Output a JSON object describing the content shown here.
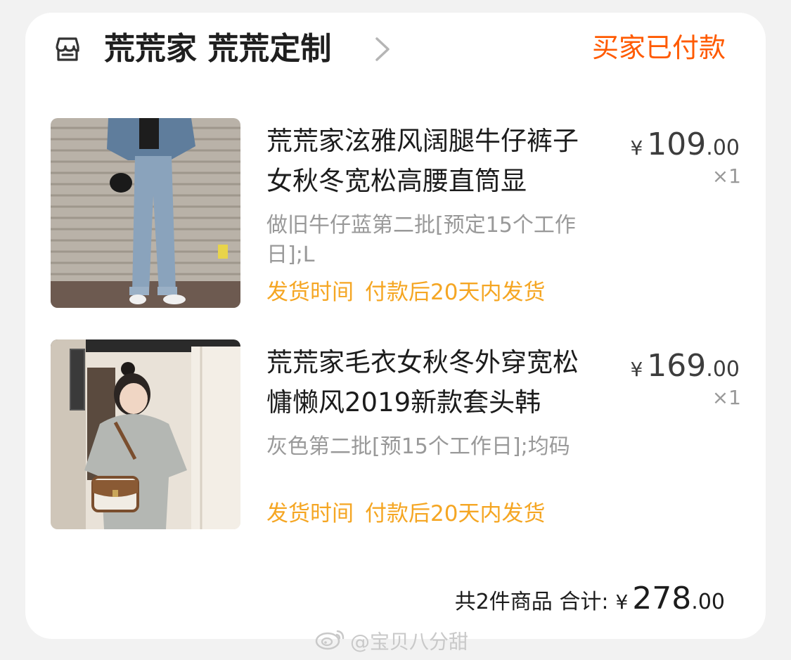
{
  "shop": {
    "name": "荒荒家 荒荒定制",
    "icon": "store-icon",
    "chevron_icon": "chevron-right-icon",
    "status": "买家已付款",
    "status_color": "#ff5a00"
  },
  "items": [
    {
      "image": "product-photo-jeans",
      "title": "荒荒家泫雅风阔腿牛仔裤子女秋冬宽松高腰直筒显",
      "sku": "做旧牛仔蓝第二批[预定15个工作日];L",
      "ship_label": "发货时间",
      "ship_value": "付款后20天内发货",
      "price_symbol": "¥",
      "price_int": "109",
      "price_dec": ".00",
      "qty": "×1"
    },
    {
      "image": "product-photo-sweater",
      "title": "荒荒家毛衣女秋冬外穿宽松慵懒风2019新款套头韩",
      "sku": "灰色第二批[预15个工作日];均码",
      "ship_label": "发货时间",
      "ship_value": "付款后20天内发货",
      "price_symbol": "¥",
      "price_int": "169",
      "price_dec": ".00",
      "qty": "×1"
    }
  ],
  "summary": {
    "count_text": "共2件商品",
    "total_label": "合计:",
    "total_symbol": "¥",
    "total_int": "278",
    "total_dec": ".00"
  },
  "watermark": {
    "text": "@宝贝八分甜",
    "icon": "weibo-icon"
  },
  "colors": {
    "ship_text": "#f5a623",
    "muted_text": "#999999",
    "background": "#f2f2f2"
  }
}
